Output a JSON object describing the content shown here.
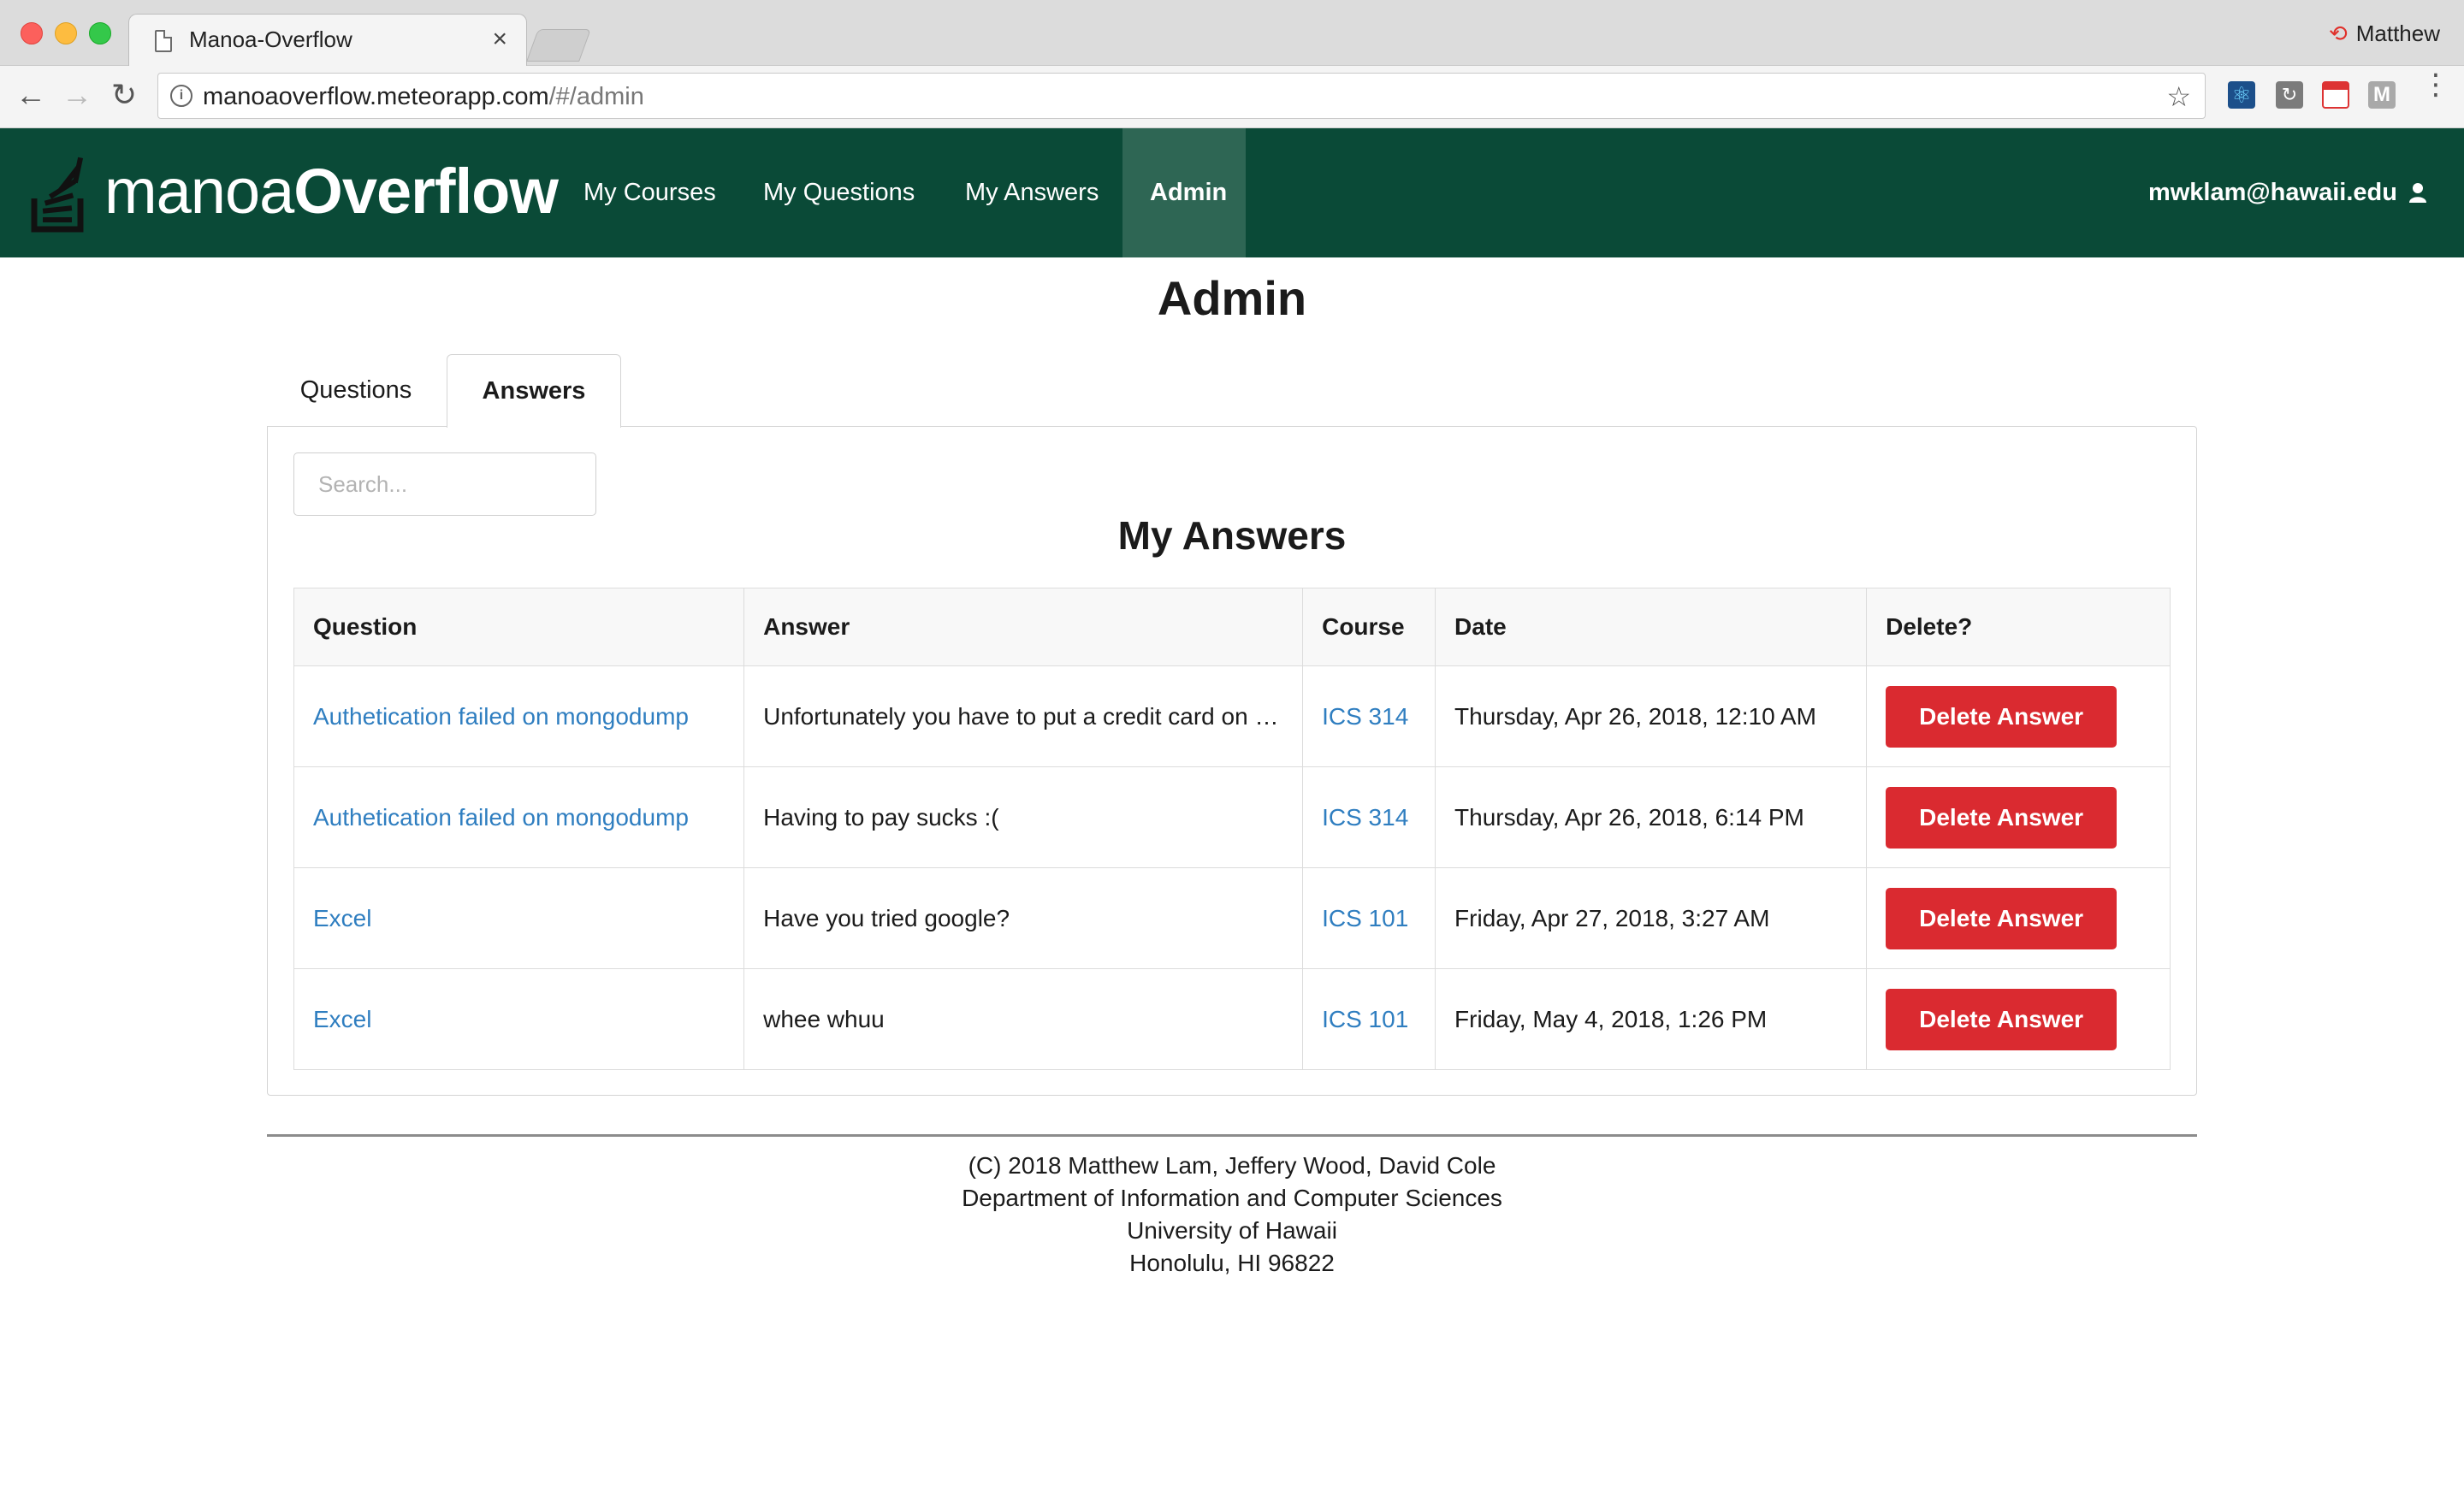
{
  "browser": {
    "tab_title": "Manoa-Overflow",
    "tab_close": "×",
    "profile_name": "Matthew",
    "url_host": "manoaoverflow.meteorapp.com",
    "url_path": "/#/admin"
  },
  "navbar": {
    "brand_light": "manoa",
    "brand_bold": "Overflow",
    "items": [
      {
        "label": "My Courses"
      },
      {
        "label": "My Questions"
      },
      {
        "label": "My Answers"
      },
      {
        "label": "Admin",
        "active": true
      }
    ],
    "user_email": "mwklam@hawaii.edu",
    "user_icon": "user-icon"
  },
  "page": {
    "title": "Admin",
    "tabs": [
      {
        "label": "Questions",
        "active": false
      },
      {
        "label": "Answers",
        "active": true
      }
    ],
    "search_placeholder": "Search...",
    "section_title": "My Answers"
  },
  "table": {
    "headers": [
      "Question",
      "Answer",
      "Course",
      "Date",
      "Delete?"
    ],
    "rows": [
      {
        "question": "Authetication failed on mongodump",
        "answer": "Unfortunately you have to put a credit card on fi…",
        "course": "ICS 314",
        "date": "Thursday, Apr 26, 2018, 12:10 AM",
        "action": "Delete Answer"
      },
      {
        "question": "Authetication failed on mongodump",
        "answer": "Having to pay sucks :(",
        "course": "ICS 314",
        "date": "Thursday, Apr 26, 2018, 6:14 PM",
        "action": "Delete Answer"
      },
      {
        "question": "Excel",
        "answer": "Have you tried google?",
        "course": "ICS 101",
        "date": "Friday, Apr 27, 2018, 3:27 AM",
        "action": "Delete Answer"
      },
      {
        "question": "Excel",
        "answer": "whee whuu",
        "course": "ICS 101",
        "date": "Friday, May 4, 2018, 1:26 PM",
        "action": "Delete Answer"
      }
    ]
  },
  "footer": {
    "lines": [
      "(C) 2018 Matthew Lam, Jeffery Wood, David Cole",
      "Department of Information and Computer Sciences",
      "University of Hawaii",
      "Honolulu, HI 96822"
    ]
  },
  "colors": {
    "navbar_bg": "#0a4a37",
    "navbar_active": "#2e6654",
    "link": "#2f7ec0",
    "danger": "#da2a30"
  }
}
